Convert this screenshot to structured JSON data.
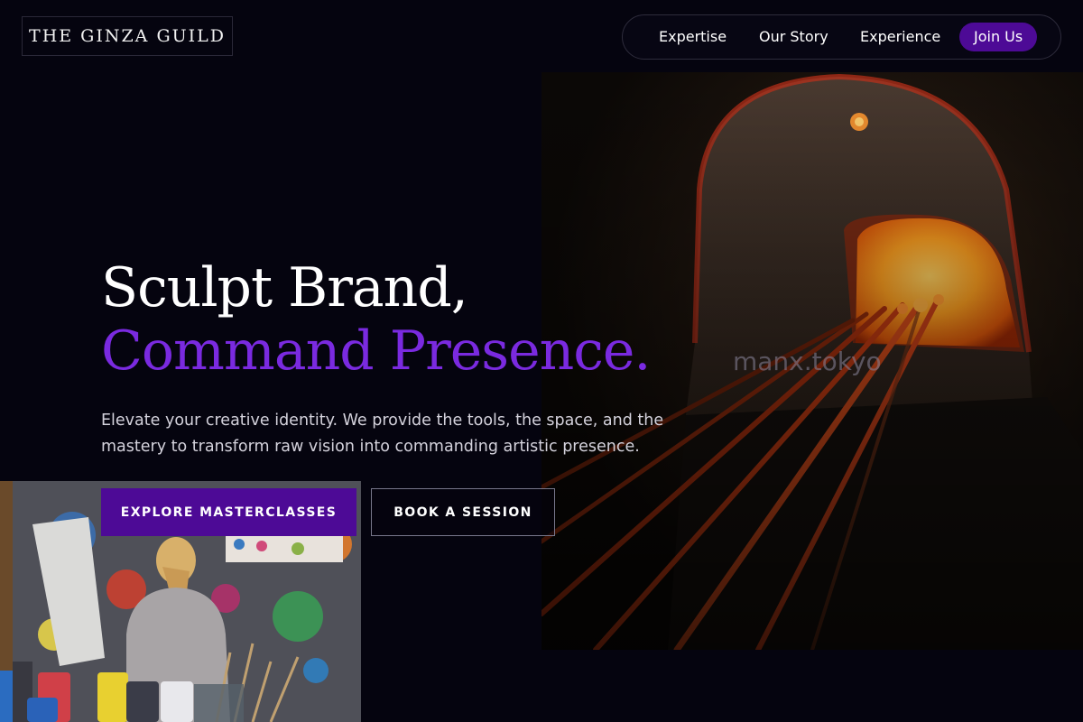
{
  "brand": {
    "name": "THE GINZA GUILD"
  },
  "nav": {
    "items": [
      {
        "label": "Expertise"
      },
      {
        "label": "Our Story"
      },
      {
        "label": "Experience"
      }
    ],
    "cta_label": "Join Us"
  },
  "hero": {
    "headline_line1": "Sculpt Brand,",
    "headline_line2": "Command Presence.",
    "subtext": "Elevate your creative identity. We provide the tools, the space, and the mastery to transform raw vision into commanding artistic presence.",
    "primary_button": "EXPLORE MASTERCLASSES",
    "secondary_button": "BOOK A SESSION"
  },
  "watermark": "manx.tokyo",
  "colors": {
    "background": "#05040f",
    "accent_purple": "#7a2ae0",
    "button_purple": "#4d0a96"
  }
}
